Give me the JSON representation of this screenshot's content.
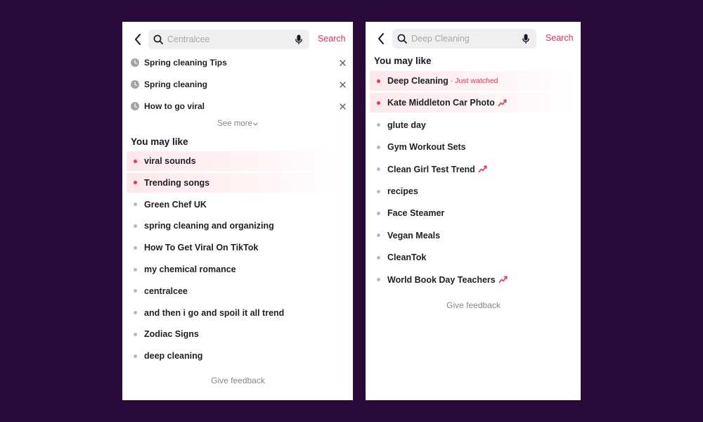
{
  "left": {
    "search": {
      "placeholder": "Centralcee",
      "action": "Search"
    },
    "history": [
      {
        "label": "Spring cleaning Tips"
      },
      {
        "label": "Spring cleaning"
      },
      {
        "label": "How to go viral"
      }
    ],
    "see_more": "See more",
    "may_like_title": "You may like",
    "may_like": [
      {
        "label": "viral sounds",
        "hot": true
      },
      {
        "label": "Trending songs",
        "hot": true
      },
      {
        "label": "Green Chef UK"
      },
      {
        "label": "spring cleaning and organizing"
      },
      {
        "label": "How To Get Viral On TikTok"
      },
      {
        "label": "my chemical romance"
      },
      {
        "label": "centralcee"
      },
      {
        "label": "and then i go and spoil it all trend"
      },
      {
        "label": "Zodiac Signs"
      },
      {
        "label": "deep cleaning"
      }
    ],
    "feedback": "Give feedback"
  },
  "right": {
    "search": {
      "placeholder": "Deep Cleaning",
      "action": "Search"
    },
    "may_like_title": "You may like",
    "may_like": [
      {
        "label": "Deep Cleaning",
        "note": "· Just watched",
        "hot": true
      },
      {
        "label": "Kate Middleton Car Photo",
        "hot": true,
        "trending": true
      },
      {
        "label": "glute day"
      },
      {
        "label": "Gym Workout Sets"
      },
      {
        "label": "Clean Girl Test Trend",
        "trending": true
      },
      {
        "label": "recipes"
      },
      {
        "label": "Face Steamer"
      },
      {
        "label": "Vegan Meals"
      },
      {
        "label": "CleanTok"
      },
      {
        "label": "World Book Day Teachers",
        "trending": true
      }
    ],
    "feedback": "Give feedback"
  },
  "colors": {
    "accent": "#fe2c55",
    "background": "#2a0a3a",
    "dot": "#b8b9bd"
  }
}
